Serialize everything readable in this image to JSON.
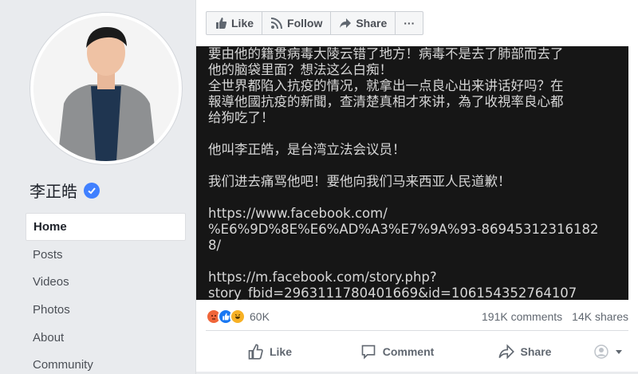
{
  "sidebar": {
    "page_name": "李正皓",
    "nav": [
      "Home",
      "Posts",
      "Videos",
      "Photos",
      "About",
      "Community"
    ]
  },
  "toolbar": {
    "like": "Like",
    "follow": "Follow",
    "share": "Share",
    "more": "···"
  },
  "post_image": {
    "lines": [
      "要由他的籍贯病毒大陵云错了地方！病毒不是去了肺部而去了",
      "他的脑袋里面？想法这么白痴！",
      "全世界都陷入抗疫的情况，就拿出一点良心出来讲话好吗？在",
      "報導他國抗疫的新聞，查清楚真相才來讲，為了收視率良心都",
      "给狗吃了！",
      "",
      "他叫李正皓，是台湾立法会议员！",
      "",
      "我们进去痛骂他吧！要他向我们马来西亚人民道歉！",
      "",
      "https://www.facebook.com/",
      "%E6%9D%8E%E6%AD%A3%E7%9A%93-86945312316182",
      "8/",
      "",
      "https://m.facebook.com/story.php?",
      "story_fbid=2963111780401669&id=106154352764107"
    ]
  },
  "stats": {
    "reaction_count": "60K",
    "comments": "191K comments",
    "shares": "14K shares"
  },
  "actions": {
    "like": "Like",
    "comment": "Comment",
    "share": "Share"
  },
  "colors": {
    "brand_blue": "#4080ff",
    "angry": "#f0663a",
    "like_blue": "#1877f2",
    "haha": "#f7b125"
  },
  "icons": [
    "like-icon",
    "follow-icon",
    "share-icon",
    "more-icon",
    "verified-icon",
    "comment-icon",
    "avatar-icon",
    "dropdown-icon"
  ]
}
